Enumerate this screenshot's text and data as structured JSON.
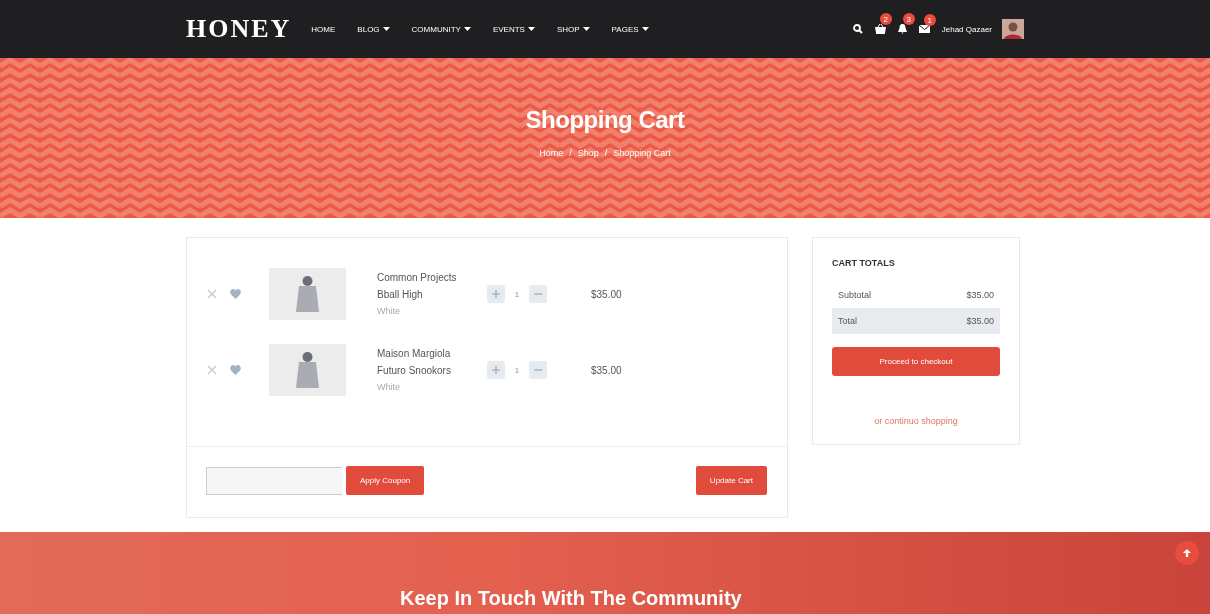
{
  "navbar": {
    "logo": "HONEY",
    "menu": [
      {
        "label": "HOME",
        "dropdown": false
      },
      {
        "label": "BLOG",
        "dropdown": true
      },
      {
        "label": "COMMUNITY",
        "dropdown": true
      },
      {
        "label": "EVENTS",
        "dropdown": true
      },
      {
        "label": "SHOP",
        "dropdown": true
      },
      {
        "label": "PAGES",
        "dropdown": true
      }
    ],
    "icons": [
      {
        "kind": "search"
      },
      {
        "kind": "cart",
        "badge": "2"
      },
      {
        "kind": "bell",
        "badge": "3"
      },
      {
        "kind": "mail",
        "badge": "1"
      }
    ],
    "user_name": "Jehad Qazaer"
  },
  "hero": {
    "title": "Shopping Cart",
    "breadcrumb": [
      "Home",
      "Shop",
      "Shopping Cart"
    ],
    "separator": "/"
  },
  "cart": {
    "items": [
      {
        "name_lines": [
          "Common Projects",
          "Bball High"
        ],
        "variant": "White",
        "quantity": "1",
        "price": "$35.00"
      },
      {
        "name_lines": [
          "Maison Margiola",
          "Futuro Snookors"
        ],
        "variant": "White",
        "quantity": "1",
        "price": "$35.00"
      }
    ],
    "coupon_button": "Apply Coupon",
    "update_button": "Update Cart"
  },
  "totals": {
    "title": "CART TOTALS",
    "rows": [
      {
        "label": "Subtotal",
        "value": "$35.00",
        "highlighted": false
      },
      {
        "label": "Total",
        "value": "$35.00",
        "highlighted": true
      }
    ],
    "checkout_button": "Proceed to checkout",
    "continue_link": "or continuo shopping"
  },
  "footer_banner": {
    "title": "Keep In Touch With The Community"
  }
}
